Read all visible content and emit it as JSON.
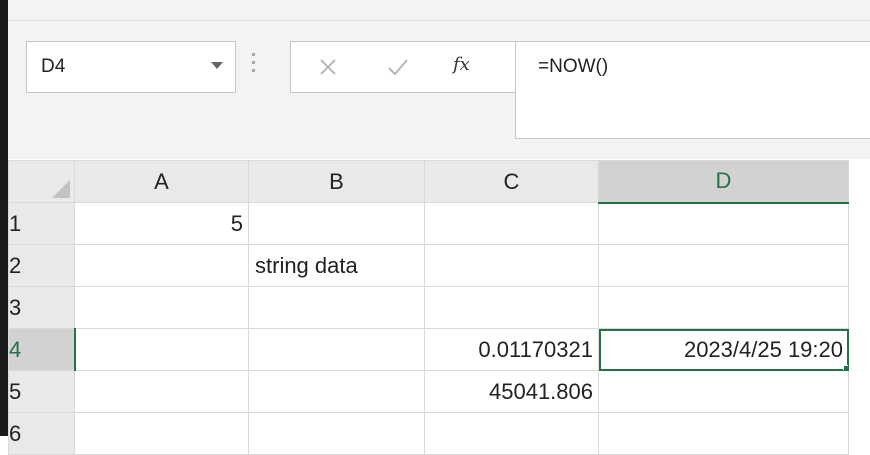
{
  "name_box": {
    "value": "D4"
  },
  "formula_bar": {
    "value": "=NOW()",
    "fx_label": "fx"
  },
  "icons": {
    "cancel": "close-icon",
    "enter": "check-icon",
    "fx": "function-icon",
    "dropdown": "chevron-down-icon"
  },
  "colors": {
    "accent": "#217346",
    "header_bg": "#e9e9e9",
    "grid_line": "#d9d9d9"
  },
  "sheet": {
    "columns": [
      "A",
      "B",
      "C",
      "D"
    ],
    "rows": [
      {
        "label": "1",
        "cells": [
          "5",
          "",
          "",
          ""
        ]
      },
      {
        "label": "2",
        "cells": [
          "",
          "string data",
          "",
          ""
        ]
      },
      {
        "label": "3",
        "cells": [
          "",
          "",
          "",
          ""
        ]
      },
      {
        "label": "4",
        "cells": [
          "",
          "",
          "0.01170321",
          "2023/4/25 19:20"
        ]
      },
      {
        "label": "5",
        "cells": [
          "",
          "",
          "45041.806",
          ""
        ]
      },
      {
        "label": "6",
        "cells": [
          "",
          "",
          "",
          ""
        ]
      }
    ],
    "active_cell": "D4"
  }
}
